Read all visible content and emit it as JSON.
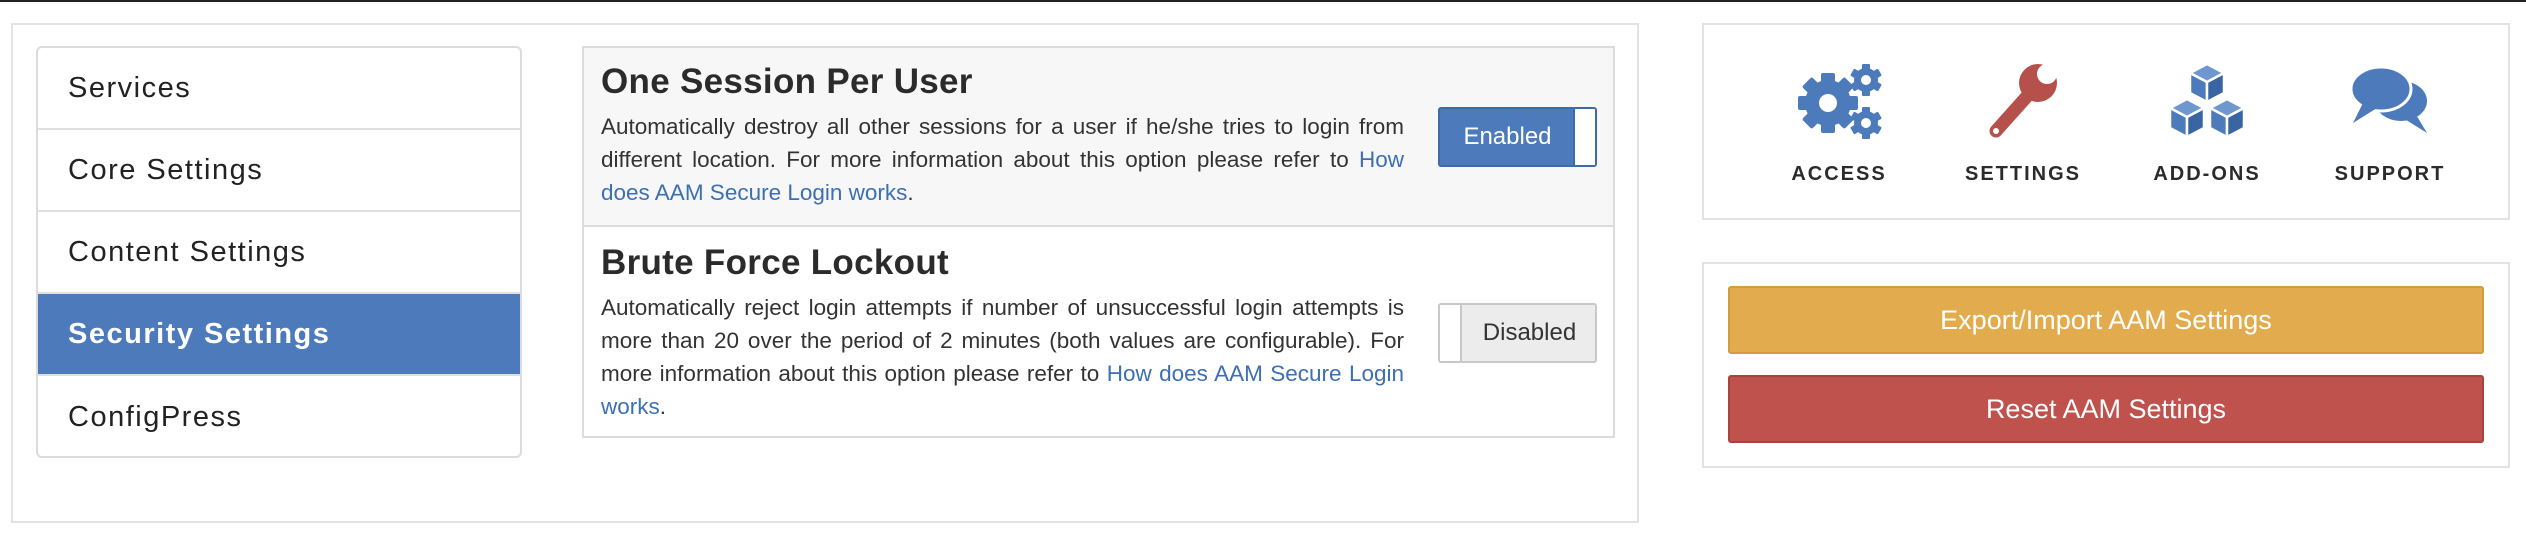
{
  "nav": {
    "items": [
      {
        "label": "Services",
        "active": false
      },
      {
        "label": "Core Settings",
        "active": false
      },
      {
        "label": "Content Settings",
        "active": false
      },
      {
        "label": "Security Settings",
        "active": true
      },
      {
        "label": "ConfigPress",
        "active": false
      }
    ]
  },
  "settings": [
    {
      "title": "One Session Per User",
      "description": "Automatically destroy all other sessions for a user if he/she tries to login from different location. For more information about this option please refer to ",
      "link_text": "How does AAM Secure Login works",
      "suffix": ".",
      "toggle_label": "Enabled",
      "enabled": true
    },
    {
      "title": "Brute Force Lockout",
      "description": "Automatically reject login attempts if number of unsuccessful login attempts is more than 20 over the period of 2 minutes (both values are configurable). For more information about this option please refer to ",
      "link_text": "How does AAM Secure Login works",
      "suffix": ".",
      "toggle_label": "Disabled",
      "enabled": false
    }
  ],
  "quick_links": [
    {
      "label": "ACCESS",
      "icon": "gears-icon"
    },
    {
      "label": "SETTINGS",
      "icon": "wrench-icon"
    },
    {
      "label": "ADD-ONS",
      "icon": "cubes-icon"
    },
    {
      "label": "SUPPORT",
      "icon": "chat-bubbles-icon"
    }
  ],
  "actions": {
    "export_label": "Export/Import AAM Settings",
    "reset_label": "Reset AAM Settings"
  },
  "colors": {
    "primary": "#4c7abb",
    "wrench": "#b5504b",
    "warning": "#e2ab4d",
    "danger": "#c0524d",
    "link": "#3c6fb4"
  }
}
